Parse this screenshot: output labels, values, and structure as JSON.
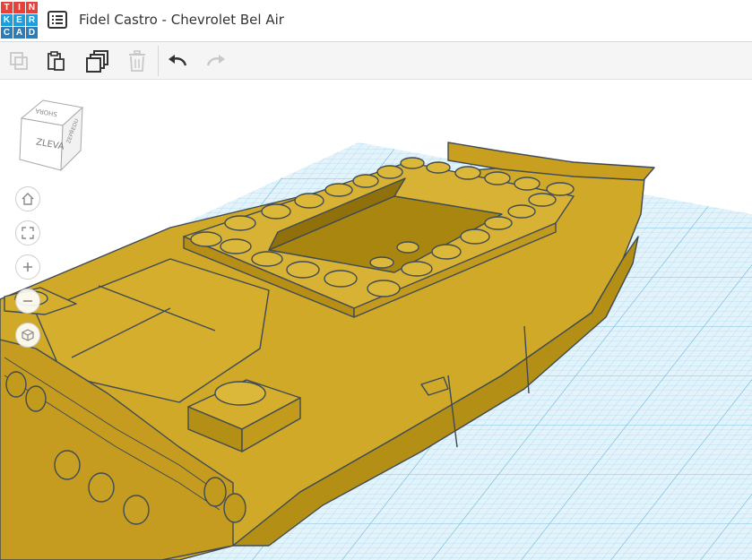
{
  "app": {
    "logo_letters": [
      "T",
      "I",
      "N",
      "K",
      "E",
      "R",
      "C",
      "A",
      "D"
    ],
    "logo_colors": [
      "#e6423a",
      "#e6423a",
      "#e6423a",
      "#19a0e0",
      "#19a0e0",
      "#19a0e0",
      "#2d7cb5",
      "#2d7cb5",
      "#2d7cb5"
    ],
    "design_title": "Fidel Castro - Chevrolet Bel Air"
  },
  "header": {
    "menu_icon": "list-icon"
  },
  "toolbar": {
    "buttons": [
      {
        "name": "copy",
        "icon": "copy-icon",
        "enabled": false
      },
      {
        "name": "paste",
        "icon": "paste-icon",
        "enabled": true
      },
      {
        "name": "duplicate",
        "icon": "duplicate-icon",
        "enabled": true
      },
      {
        "name": "delete",
        "icon": "trash-icon",
        "enabled": false
      },
      {
        "name": "undo",
        "icon": "undo-arrow-icon",
        "enabled": true
      },
      {
        "name": "redo",
        "icon": "redo-arrow-icon",
        "enabled": false
      }
    ]
  },
  "viewcube": {
    "face_front": "ZLEVA",
    "face_top": "SHORA",
    "face_side": "ZEPŘEDU"
  },
  "nav_controls": [
    "home-view-icon",
    "fit-view-icon",
    "zoom-in-icon",
    "zoom-out-icon",
    "perspective-icon"
  ],
  "scene": {
    "object": "car body model",
    "object_color": "#d1a928",
    "grid_color": "#a9d6ec",
    "workplane_color": "#e3f3fb"
  }
}
